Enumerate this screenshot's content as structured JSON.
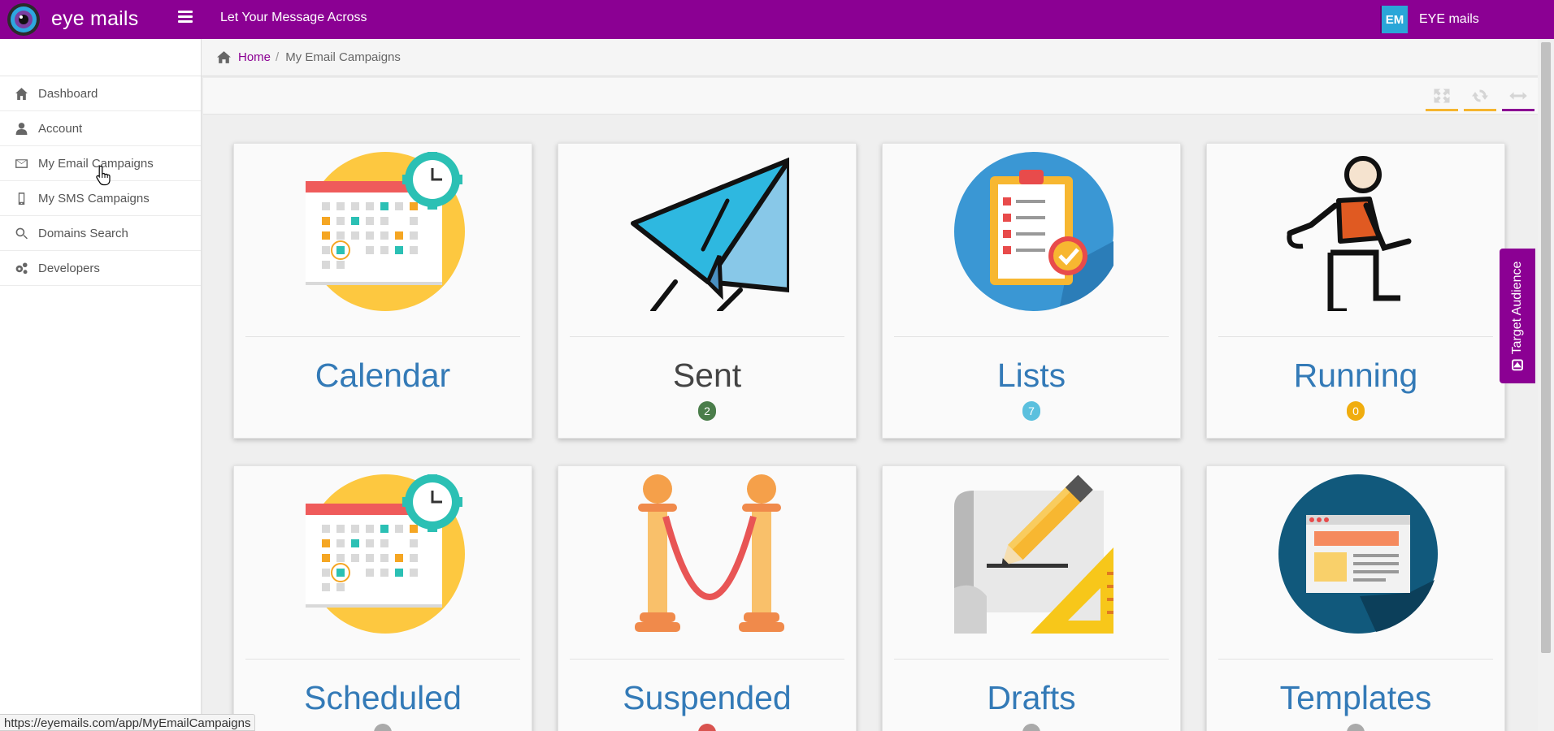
{
  "app": {
    "brand": "eye mails",
    "tagline": "Let Your Message Across",
    "user_initials": "EM",
    "user_name": "EYE mails",
    "accent_color": "#8b0093"
  },
  "sidebar": {
    "items": [
      {
        "label": "Dashboard",
        "icon": "home-icon"
      },
      {
        "label": "Account",
        "icon": "user-icon"
      },
      {
        "label": "My Email Campaigns",
        "icon": "envelope-icon"
      },
      {
        "label": "My SMS Campaigns",
        "icon": "mobile-icon"
      },
      {
        "label": "Domains Search",
        "icon": "search-icon"
      },
      {
        "label": "Developers",
        "icon": "gears-icon"
      }
    ]
  },
  "breadcrumb": {
    "home": "Home",
    "separator": "/",
    "current": "My Email Campaigns"
  },
  "panel_tools": [
    "expand-icon",
    "refresh-icon",
    "collapse-icon"
  ],
  "cards": [
    {
      "title": "Calendar",
      "badge": "",
      "icon": "calendar-clock-icon"
    },
    {
      "title": "Sent",
      "badge": "2",
      "badge_color": "#4a7d4a",
      "icon": "paper-plane-icon"
    },
    {
      "title": "Lists",
      "badge": "7",
      "badge_color": "#5bc0de",
      "icon": "clipboard-list-icon"
    },
    {
      "title": "Running",
      "badge": "0",
      "badge_color": "#f0ad0e",
      "icon": "running-person-icon"
    },
    {
      "title": "Scheduled",
      "badge": "",
      "badge_color": "#aaaaaa",
      "icon": "calendar-clock-icon"
    },
    {
      "title": "Suspended",
      "badge": "",
      "badge_color": "#d9534f",
      "icon": "velvet-rope-icon"
    },
    {
      "title": "Drafts",
      "badge": "",
      "badge_color": "#aaaaaa",
      "icon": "blueprint-pencil-icon"
    },
    {
      "title": "Templates",
      "badge": "",
      "badge_color": "#aaaaaa",
      "icon": "browser-template-icon"
    }
  ],
  "target_audience": "Target Audience",
  "status_url": "https://eyemails.com/app/MyEmailCampaigns"
}
